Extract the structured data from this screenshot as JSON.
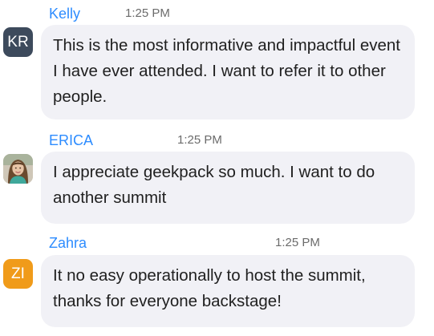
{
  "messages": [
    {
      "sender": "Kelly",
      "time": "1:25 PM",
      "avatar": {
        "initials": "KR",
        "color": "#3d4a5c"
      },
      "text": "This is the most informative and impactful event I have ever attended.  I want to refer it to other people."
    },
    {
      "sender": "ERICA",
      "time": "1:25 PM",
      "avatar": {
        "type": "photo",
        "description_icon": "user-photo-icon"
      },
      "text": "I appreciate geekpack so much. I want to do another summit"
    },
    {
      "sender": "Zahra",
      "time": "1:25 PM",
      "avatar": {
        "initials": "ZI",
        "color": "#f09b1a"
      },
      "text": "It no easy operationally to host the summit, thanks for everyone backstage!"
    }
  ],
  "colors": {
    "sender_name": "#2d8cff",
    "timestamp": "#6b6b6b",
    "bubble_bg": "#f1f1f6",
    "message_text": "#1f1f1f"
  }
}
